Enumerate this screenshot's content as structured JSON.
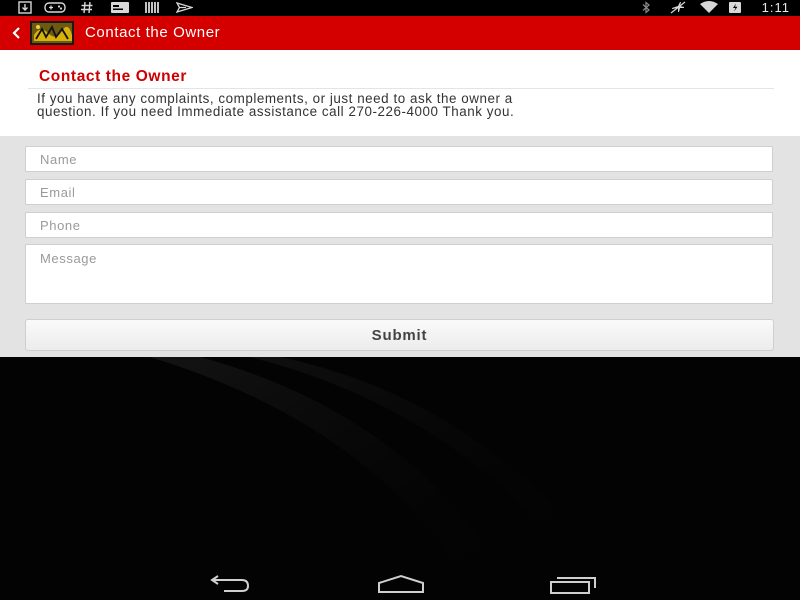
{
  "status_bar": {
    "time": "1:11",
    "left_icons": [
      "download-icon",
      "gamepad-icon",
      "hashtag-icon",
      "card-icon",
      "barcode-icon",
      "send-icon"
    ],
    "right_icons": [
      "bluetooth-icon",
      "airplane-mute-icon",
      "wifi-icon",
      "battery-icon"
    ]
  },
  "app_bar": {
    "title": "Contact the Owner",
    "brand_color": "#d40000"
  },
  "page": {
    "heading": "Contact the Owner",
    "heading_color": "#cc0000",
    "intro_line1": "If you have any complaints, complements, or just need to ask the owner a",
    "intro_line2": "question. If you need Immediate assistance call 270-226-4000 Thank you."
  },
  "form": {
    "name_placeholder": "Name",
    "email_placeholder": "Email",
    "phone_placeholder": "Phone",
    "message_placeholder": "Message",
    "submit_label": "Submit"
  },
  "nav_bar": {
    "buttons": [
      "back-nav-icon",
      "home-nav-icon",
      "recents-nav-icon"
    ]
  }
}
